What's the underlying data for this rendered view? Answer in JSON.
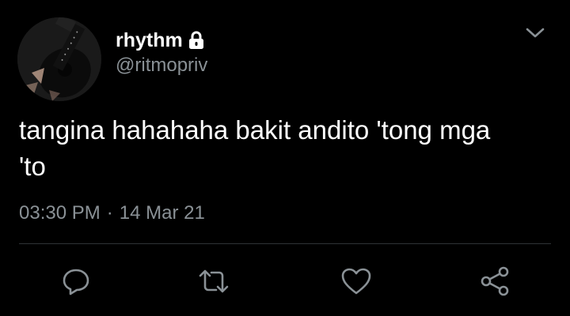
{
  "tweet": {
    "user": {
      "display_name": "rhythm",
      "handle": "@ritmopriv",
      "protected_icon": "lock-icon",
      "avatar": "guitar-photo"
    },
    "text": "tangina hahahaha bakit andito 'tong mga\n'to",
    "time": "03:30 PM",
    "separator": "·",
    "date": "14 Mar 21",
    "menu_icon": "chevron-down-icon",
    "actions": {
      "reply_icon": "reply-icon",
      "retweet_icon": "retweet-icon",
      "like_icon": "heart-icon",
      "share_icon": "share-icon"
    }
  },
  "colors": {
    "background": "#000000",
    "text_primary": "#ffffff",
    "text_secondary": "#8a9196",
    "divider": "#2f3336"
  }
}
